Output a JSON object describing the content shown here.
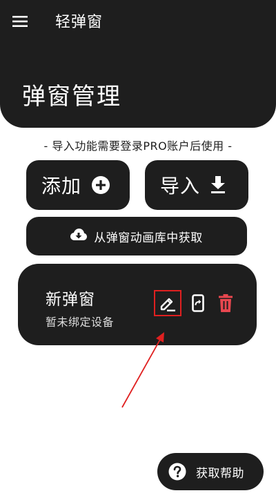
{
  "app": {
    "title": "轻弹窗",
    "menu_icon": "menu-icon"
  },
  "header": {
    "page_title": "弹窗管理"
  },
  "notice": {
    "text": "- 导入功能需要登录PRO账户后使用 -"
  },
  "actions": {
    "add_label": "添加",
    "add_icon": "plus-circle-icon",
    "import_label": "导入",
    "import_icon": "download-icon",
    "library_label": "从弹窗动画库中获取",
    "library_icon": "cloud-download-icon"
  },
  "popup_card": {
    "name": "新弹窗",
    "status": "暂未绑定设备",
    "edit_icon": "pencil-icon",
    "bind_icon": "phone-share-icon",
    "delete_icon": "trash-icon"
  },
  "help": {
    "label": "获取帮助",
    "icon": "help-circle-icon"
  },
  "colors": {
    "dark": "#1e1e1e",
    "accent_red": "#e02020",
    "delete_red": "#e8474f",
    "background": "#ffffff"
  }
}
